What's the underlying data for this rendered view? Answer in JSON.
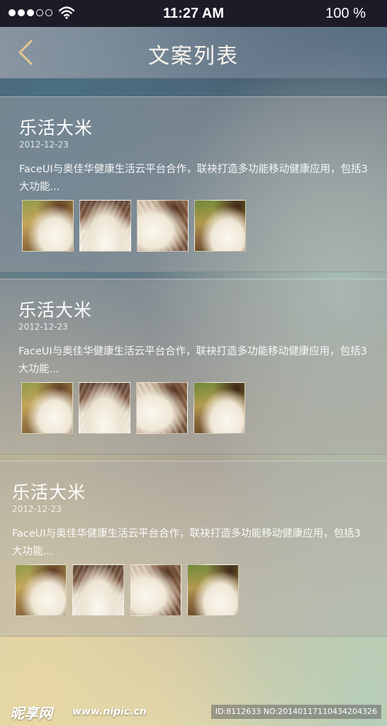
{
  "status_bar": {
    "time": "11:27 AM",
    "battery": "100 %",
    "signal_dots_filled": 3,
    "signal_dots_total": 5
  },
  "nav": {
    "title": "文案列表",
    "back_icon": "chevron-left-icon"
  },
  "posts": [
    {
      "title": "乐活大米",
      "date": "2012-12-23",
      "description": "FaceUI与奥佳华健康生活云平台合作，联袂打造多功能移动健康应用，包括3大功能..."
    },
    {
      "title": "乐活大米",
      "date": "2012-12-23",
      "description": "FaceUI与奥佳华健康生活云平台合作，联袂打造多功能移动健康应用，包括3大功能..."
    },
    {
      "title": "乐活大米",
      "date": "2012-12-23",
      "description": "FaceUI与奥佳华健康生活云平台合作，联袂打造多功能移动健康应用，包括3大功能..."
    }
  ],
  "watermark": {
    "logo": "昵享网",
    "url": "www.nipic.cn",
    "id_text": "ID:8112633 NO:20140117110434204326"
  },
  "colors": {
    "status_bar": "#1b1c28",
    "text": "#ffffff"
  }
}
